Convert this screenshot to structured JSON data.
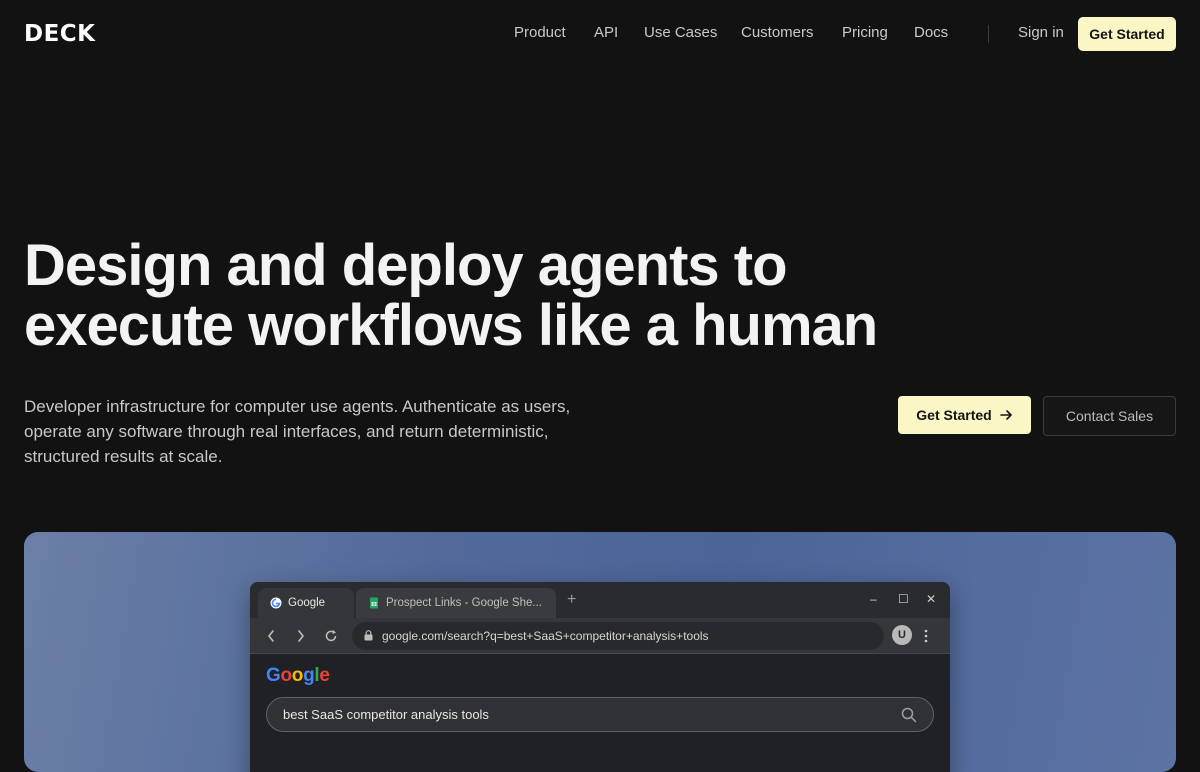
{
  "brand": {
    "logo": "DECK"
  },
  "nav": {
    "items": [
      {
        "label": "Product"
      },
      {
        "label": "API"
      },
      {
        "label": "Use Cases"
      },
      {
        "label": "Customers"
      },
      {
        "label": "Pricing"
      },
      {
        "label": "Docs"
      }
    ],
    "signin_label": "Sign in",
    "cta_label": "Get Started"
  },
  "hero": {
    "title_line1": "Design and deploy agents to",
    "title_line2": "execute workflows like a human",
    "subtitle": "Developer infrastructure for computer use agents. Authenticate as users, operate any software through real interfaces, and return deterministic, structured results at scale.",
    "primary_label": "Get Started",
    "primary_icon": "arrow-right-icon",
    "secondary_label": "Contact Sales"
  },
  "browser": {
    "tabs": [
      {
        "title": "Google",
        "icon": "google-favicon-icon",
        "active": true
      },
      {
        "title": "Prospect Links - Google She...",
        "icon": "sheets-favicon-icon",
        "active": false
      }
    ],
    "new_tab_glyph": "+",
    "window_controls": [
      "–",
      "☐",
      "✕"
    ],
    "url": "google.com/search?q=best+SaaS+competitor+analysis+tools",
    "avatar_letter": "U",
    "page": {
      "logo_letters": [
        {
          "ch": "G",
          "color": "#4285F4"
        },
        {
          "ch": "o",
          "color": "#EA4335"
        },
        {
          "ch": "o",
          "color": "#FBBC05"
        },
        {
          "ch": "g",
          "color": "#4285F4"
        },
        {
          "ch": "l",
          "color": "#34A853"
        },
        {
          "ch": "e",
          "color": "#EA4335"
        }
      ],
      "search_query": "best SaaS competitor analysis tools"
    }
  },
  "colors": {
    "background": "#121212",
    "accent_button": "#fbf6c6",
    "showcase_gradient": [
      "#6b7fa7",
      "#4b6599"
    ]
  }
}
